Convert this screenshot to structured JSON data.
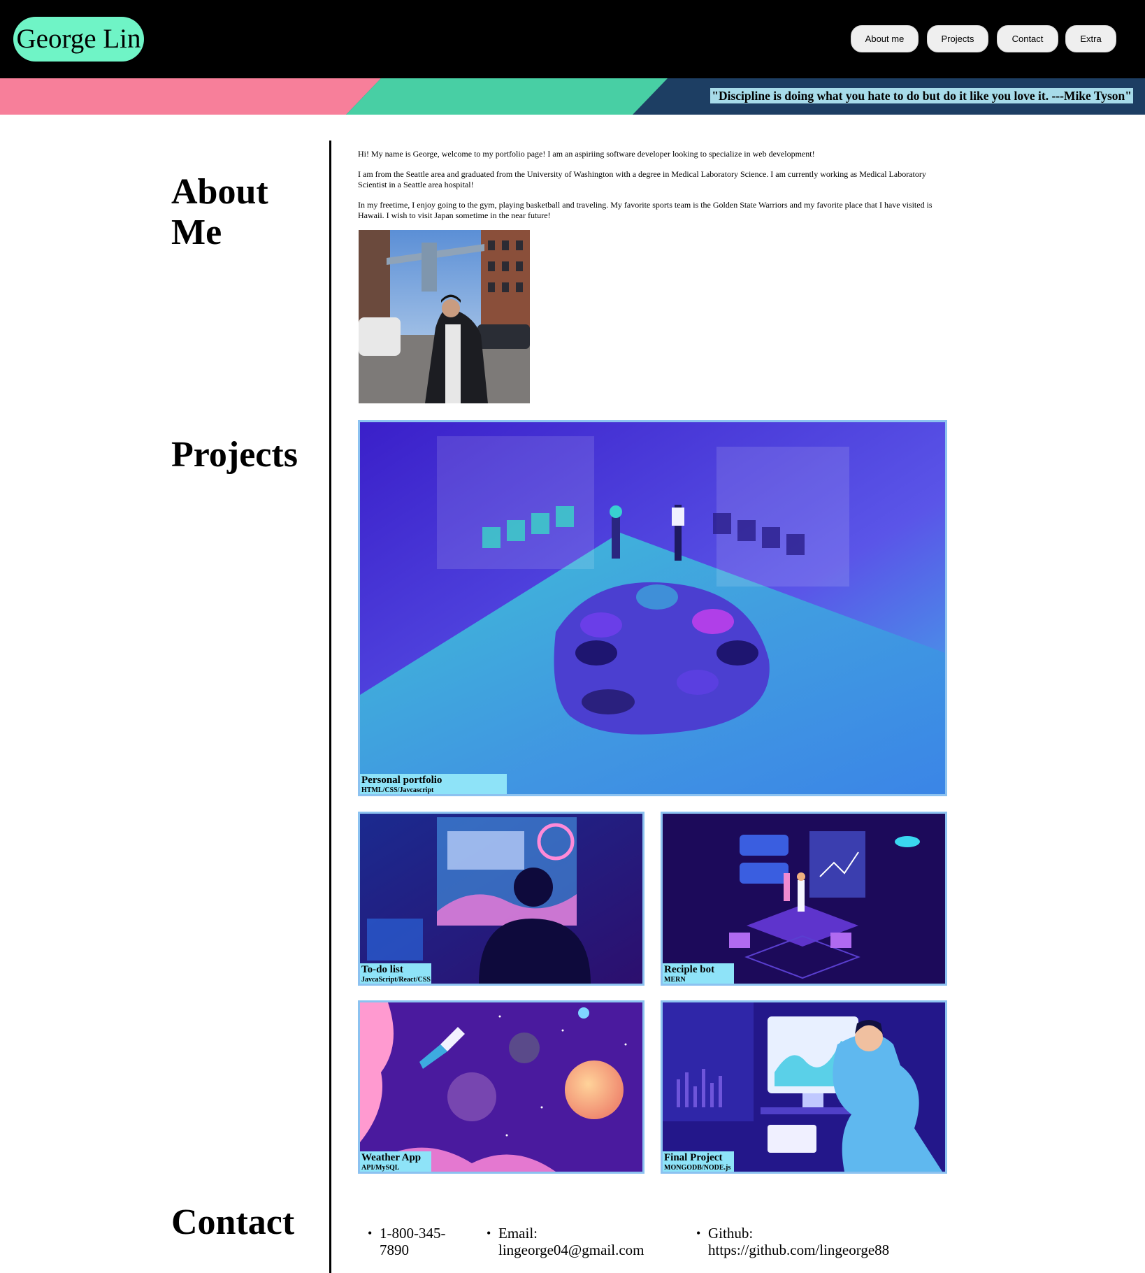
{
  "header": {
    "logo": "George Lin",
    "nav": [
      "About me",
      "Projects",
      "Contact",
      "Extra"
    ]
  },
  "banner": {
    "quote": "\"Discipline is doing what you hate to do but do it like you love it. ---Mike Tyson\""
  },
  "about": {
    "title": "About Me",
    "paragraphs": [
      "Hi! My name is George, welcome to my portfolio page! I am an aspiriing software developer looking to specialize in web development!",
      "I am from the Seattle area and graduated from the University of Washington with a degree in Medical Laboratory Science. I am currently working as Medical Laboratory Scientist in a Seattle area hospital!",
      "In my freetime, I enjoy going to the gym, playing basketball and traveling. My favorite sports team is the Golden State Warriors and my favorite place that I have visited is Hawaii. I wish to visit Japan sometime in the near future!"
    ]
  },
  "projects": {
    "title": "Projects",
    "items": [
      {
        "name": "Personal portfolio",
        "tech": "HTML/CSS/Javcascript"
      },
      {
        "name": "To-do list",
        "tech": "JavcaScript/React/CSS"
      },
      {
        "name": "Reciple bot",
        "tech": "MERN"
      },
      {
        "name": "Weather App",
        "tech": "API/MySQL"
      },
      {
        "name": "Final Project",
        "tech": "MONGODB/NODE.js"
      }
    ]
  },
  "contact": {
    "title": "Contact",
    "items": [
      "1-800-345-7890",
      "Email: lingeorge04@gmail.com",
      "Github: https://github.com/lingeorge88"
    ]
  },
  "colors": {
    "logo_bg": "#6ff4c6",
    "banner_pink": "#f77f9a",
    "banner_green": "#48cfa4",
    "banner_navy": "#1d3e63",
    "label_bg": "#8ee3f8",
    "card_border": "#8cc2f0"
  }
}
